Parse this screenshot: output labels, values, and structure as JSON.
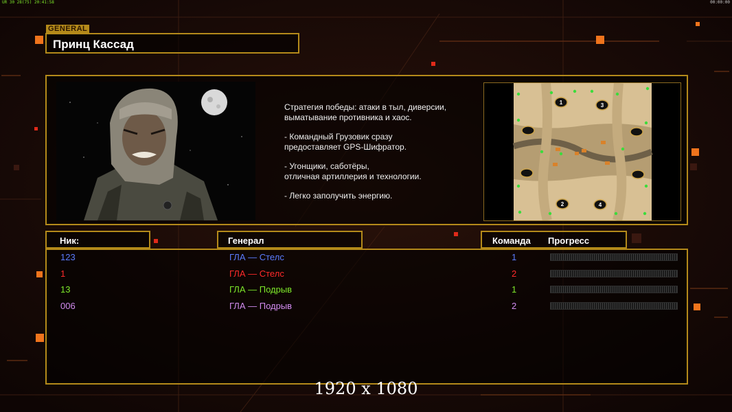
{
  "topbar": {
    "left": "UR 30 28(75) 20:41:58",
    "right": "00:00:00"
  },
  "general_tag": "GENERAL",
  "general_name": "Принц Кассад",
  "description": {
    "line1": "Стратегия победы: атаки в тыл, диверсии,",
    "line2": " выматывание противника и хаос.",
    "line3": "- Командный Грузовик сразу",
    "line4": "предоставляет GPS-Шифратор.",
    "line5": "- Угонщики, саботёры,",
    "line6": "отличная артиллерия и технологии.",
    "line7": "- Легко заполучить энергию."
  },
  "minimap": {
    "spawns": [
      "1",
      "2",
      "3",
      "4"
    ]
  },
  "headers": {
    "nick": "Ник:",
    "general": "Генерал",
    "team": "Команда",
    "progress": "Прогресс"
  },
  "players": [
    {
      "nick": "123",
      "general": "ГЛА — Стелс",
      "team": "1",
      "color": "#5b7cff",
      "progress": 0
    },
    {
      "nick": "1",
      "general": "ГЛА — Стелс",
      "team": "2",
      "color": "#ff2a2a",
      "progress": 0
    },
    {
      "nick": "13",
      "general": "ГЛА — Подрыв",
      "team": "1",
      "color": "#7ee82a",
      "progress": 0
    },
    {
      "nick": "006",
      "general": "ГЛА — Подрыв",
      "team": "2",
      "color": "#d38cf0",
      "progress": 0
    }
  ],
  "resolution_label": "1920 x 1080",
  "colors": {
    "frame": "#b48a1a",
    "background": "#140806"
  }
}
